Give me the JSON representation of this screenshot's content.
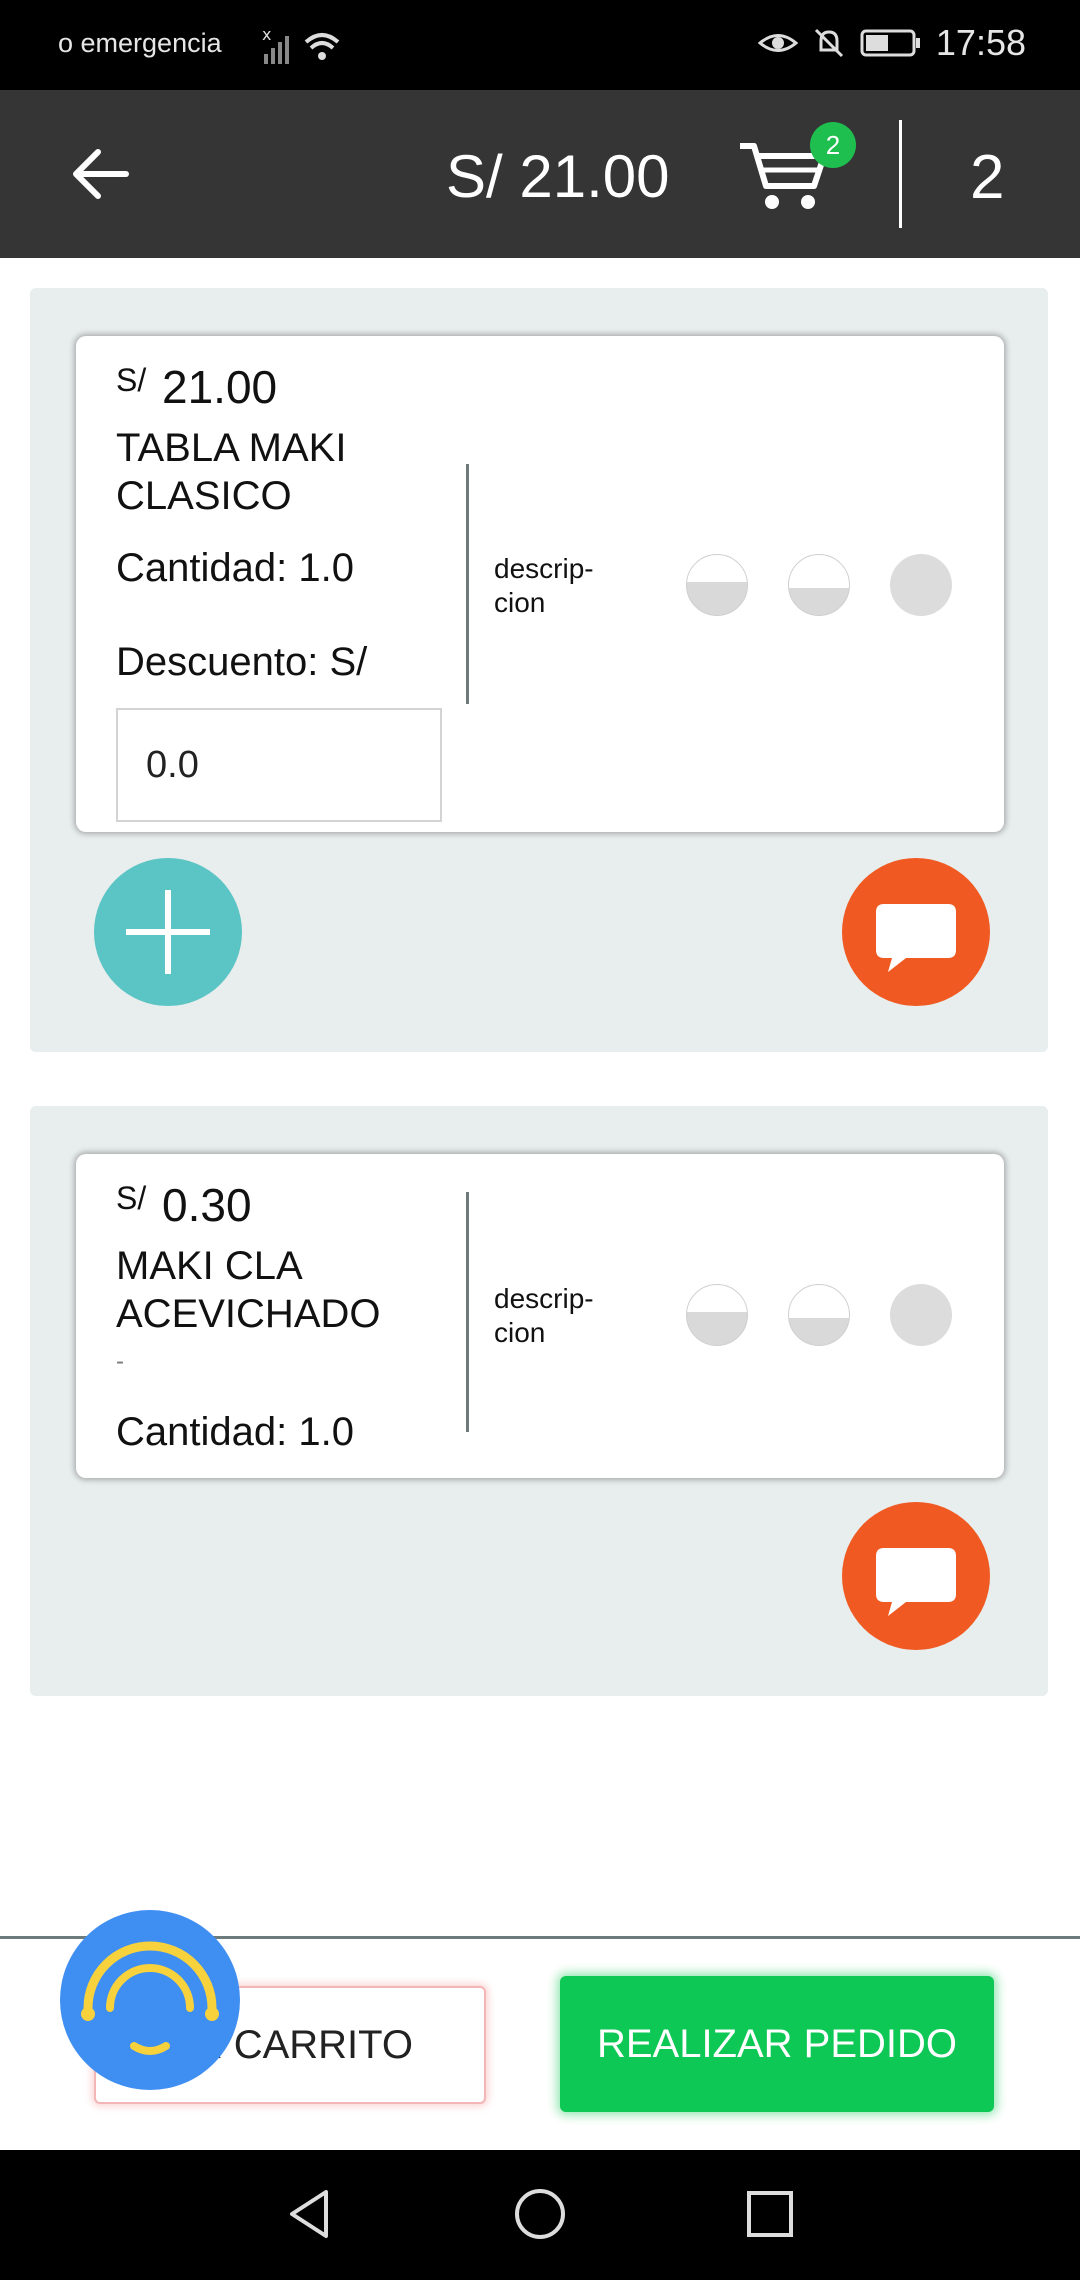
{
  "status_bar": {
    "carrier": "o emergencia",
    "time": "17:58"
  },
  "header": {
    "total": "S/ 21.00",
    "cart_badge": "2",
    "item_count": "2"
  },
  "items": [
    {
      "currency": "S/",
      "price": "21.00",
      "name": "TABLA MAKI CLASICO",
      "quantity_label": "Cantidad: 1.0",
      "discount_label": "Descuento:  S/",
      "discount_value": "0.0",
      "description": "descrip-cion"
    },
    {
      "currency": "S/",
      "price": "0.30",
      "name": "MAKI CLA ACEVICHADO",
      "note": "-",
      "quantity_label": "Cantidad: 1.0",
      "description": "descrip-cion"
    }
  ],
  "footer": {
    "clear_label": "AR CARRITO",
    "order_label": "REALIZAR PEDIDO"
  },
  "colors": {
    "appbar": "#353535",
    "add_fab": "#5bc4c4",
    "chat_fab": "#f05a22",
    "order_button": "#0dc855",
    "assistant": "#3f8ef2"
  }
}
